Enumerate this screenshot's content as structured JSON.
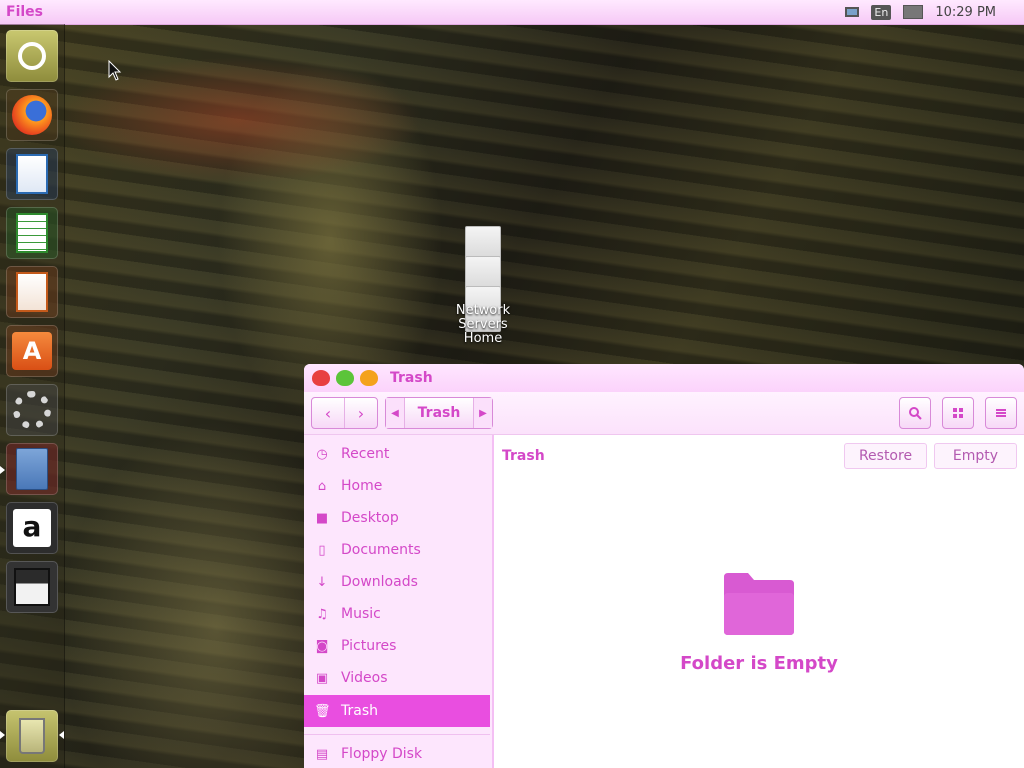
{
  "top_panel": {
    "app_title": "Files",
    "lang": "En",
    "clock": "10:29 PM"
  },
  "launcher": {
    "items": [
      {
        "name": "ubuntu-dash",
        "icon": "ubuntu-logo-icon"
      },
      {
        "name": "firefox",
        "icon": "firefox-icon"
      },
      {
        "name": "writer",
        "icon": "libreoffice-writer-icon"
      },
      {
        "name": "calc",
        "icon": "libreoffice-calc-icon"
      },
      {
        "name": "impress",
        "icon": "libreoffice-impress-icon"
      },
      {
        "name": "software",
        "icon": "ubuntu-software-icon"
      },
      {
        "name": "settings",
        "icon": "system-settings-icon"
      },
      {
        "name": "files",
        "icon": "file-cabinet-icon"
      },
      {
        "name": "amazon",
        "icon": "amazon-icon"
      },
      {
        "name": "floppy",
        "icon": "floppy-disk-icon"
      },
      {
        "name": "trash",
        "icon": "trash-icon"
      }
    ]
  },
  "desktop_icon": {
    "lines": [
      "Network",
      "Servers",
      "Home"
    ]
  },
  "window": {
    "title": "Trash",
    "toolbar": {
      "breadcrumb": "Trash",
      "back_glyph": "‹",
      "forward_glyph": "›"
    },
    "sidebar": {
      "items": [
        {
          "label": "Recent",
          "icon": "clock-icon"
        },
        {
          "label": "Home",
          "icon": "home-icon"
        },
        {
          "label": "Desktop",
          "icon": "folder-icon"
        },
        {
          "label": "Documents",
          "icon": "document-icon"
        },
        {
          "label": "Downloads",
          "icon": "download-icon"
        },
        {
          "label": "Music",
          "icon": "music-icon"
        },
        {
          "label": "Pictures",
          "icon": "camera-icon"
        },
        {
          "label": "Videos",
          "icon": "video-icon"
        },
        {
          "label": "Trash",
          "icon": "trash-icon",
          "active": true
        },
        {
          "label": "Floppy Disk",
          "icon": "floppy-icon"
        }
      ]
    },
    "content": {
      "path": "Trash",
      "restore_label": "Restore",
      "empty_label": "Empty",
      "empty_message": "Folder is Empty"
    }
  },
  "colors": {
    "accent": "#d448c8",
    "active_row": "#e94ee0",
    "sidebar_bg": "#fde6fd"
  }
}
